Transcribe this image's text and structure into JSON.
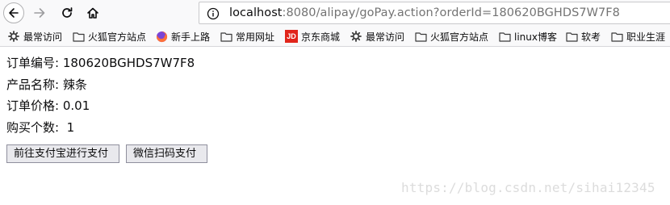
{
  "browser": {
    "url": {
      "host": "localhost",
      "rest": ":8080/alipay/goPay.action?orderId=180620BGHDS7W7F8"
    }
  },
  "bookmarks": [
    {
      "label": "最常访问",
      "icon": "gear-icon"
    },
    {
      "label": "火狐官方站点",
      "icon": "folder-icon"
    },
    {
      "label": "新手上路",
      "icon": "firefox-icon"
    },
    {
      "label": "常用网址",
      "icon": "folder-icon"
    },
    {
      "label": "京东商城",
      "icon": "jd-icon"
    },
    {
      "label": "最常访问",
      "icon": "gear-icon"
    },
    {
      "label": "火狐官方站点",
      "icon": "folder-icon"
    },
    {
      "label": "linux博客",
      "icon": "folder-icon"
    },
    {
      "label": "软考",
      "icon": "folder-icon"
    },
    {
      "label": "职业生涯",
      "icon": "folder-icon"
    }
  ],
  "jd_badge": "JD",
  "order": {
    "id_label": "订单编号:",
    "id_value": "180620BGHDS7W7F8",
    "name_label": "产品名称:",
    "name_value": "辣条",
    "price_label": "订单价格:",
    "price_value": "0.01",
    "qty_label": "购买个数:",
    "qty_value": "1"
  },
  "buttons": {
    "alipay": "前往支付宝进行支付",
    "wechat": "微信扫码支付"
  },
  "watermark": "https://blog.csdn.net/sihai12345",
  "colors": {
    "jd_red": "#e1251b",
    "firefox_orange": "#ff7139",
    "firefox_purple": "#7a45d6"
  }
}
